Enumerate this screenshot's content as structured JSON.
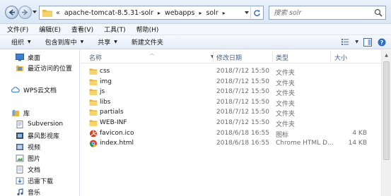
{
  "address": {
    "prefix": "«",
    "segments": [
      "apache-tomcat-8.5.31-solr",
      "webapps",
      "solr"
    ],
    "separator": "▸"
  },
  "search": {
    "placeholder": "搜索 solr"
  },
  "menu": [
    "文件(F)",
    "编辑(E)",
    "查看(V)",
    "工具(T)",
    "帮助(H)"
  ],
  "toolbar": {
    "organize": "组织",
    "include": "包含到库中",
    "share": "共享",
    "new_folder": "新建文件夹"
  },
  "nav": {
    "desktop": "桌面",
    "recent": "最近访问的位置",
    "wps": "WPS云文档",
    "libraries": "库",
    "subversion": "Subversion",
    "video_lib": "暴风影视库",
    "videos": "视频",
    "pictures": "图片",
    "documents": "文档",
    "downloads": "迅雷下载",
    "music": "音乐"
  },
  "columns": {
    "name": "名称",
    "date": "修改日期",
    "type": "类型",
    "size": "大小"
  },
  "files": [
    {
      "name": "css",
      "date": "2018/7/12 15:50",
      "type": "文件夹",
      "size": "",
      "icon": "folder-icon"
    },
    {
      "name": "img",
      "date": "2018/7/12 15:50",
      "type": "文件夹",
      "size": "",
      "icon": "folder-icon"
    },
    {
      "name": "js",
      "date": "2018/7/12 15:50",
      "type": "文件夹",
      "size": "",
      "icon": "folder-icon"
    },
    {
      "name": "libs",
      "date": "2018/7/12 15:50",
      "type": "文件夹",
      "size": "",
      "icon": "folder-icon"
    },
    {
      "name": "partials",
      "date": "2018/7/12 15:50",
      "type": "文件夹",
      "size": "",
      "icon": "folder-icon"
    },
    {
      "name": "WEB-INF",
      "date": "2018/7/12 15:50",
      "type": "文件夹",
      "size": "",
      "icon": "folder-icon"
    },
    {
      "name": "favicon.ico",
      "date": "2018/6/18 16:55",
      "type": "图标",
      "size": "4 KB",
      "icon": "solr-favicon-icon"
    },
    {
      "name": "index.html",
      "date": "2018/6/18 16:55",
      "type": "Chrome HTML D...",
      "size": "14 KB",
      "icon": "chrome-icon"
    }
  ],
  "colors": {
    "folder": "#f2c84b",
    "accent": "#3c6fb5"
  }
}
